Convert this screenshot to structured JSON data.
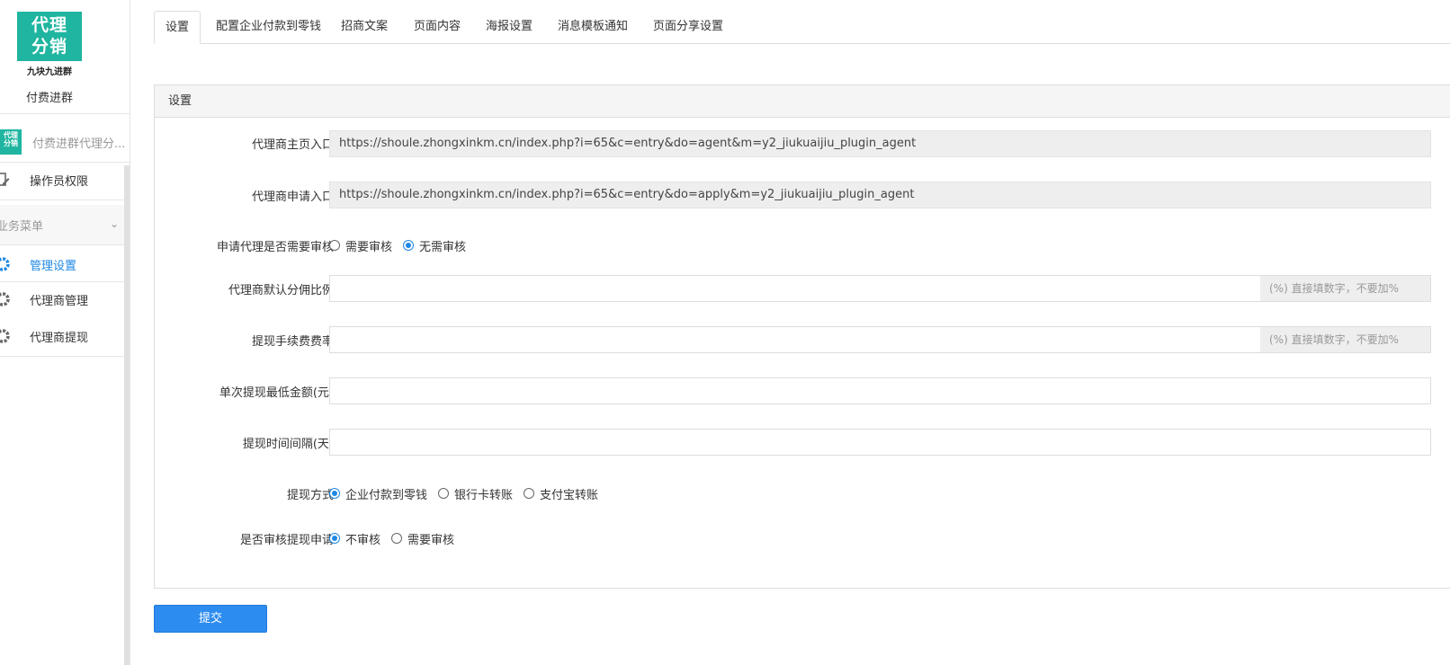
{
  "sidebar": {
    "logo_text_line1": "代理",
    "logo_text_line2": "分销",
    "logo_subtitle": "九块九进群",
    "app_name": "付费进群",
    "module": {
      "thumb_line1": "代理",
      "thumb_line2": "分销",
      "label": "付费进群代理分..."
    },
    "operator_permissions": "操作员权限",
    "section_title": "业务菜单",
    "items": [
      {
        "label": "管理设置",
        "icon": "gear-icon",
        "active": true
      },
      {
        "label": "代理商管理",
        "icon": "gear-icon",
        "active": false
      },
      {
        "label": "代理商提现",
        "icon": "gear-icon",
        "active": false
      }
    ],
    "accent_color": "#1e88e5",
    "logo_color": "#1fb5a0"
  },
  "tabs": [
    {
      "label": "设置",
      "active": true
    },
    {
      "label": "配置企业付款到零钱"
    },
    {
      "label": "招商文案"
    },
    {
      "label": "页面内容"
    },
    {
      "label": "海报设置"
    },
    {
      "label": "消息模板通知"
    },
    {
      "label": "页面分享设置"
    }
  ],
  "panel": {
    "title": "设置",
    "agent_home": {
      "label": "代理商主页入口",
      "value": "https://shoule.zhongxinkm.cn/index.php?i=65&c=entry&do=agent&m=y2_jiukuaijiu_plugin_agent"
    },
    "agent_apply": {
      "label": "代理商申请入口",
      "value": "https://shoule.zhongxinkm.cn/index.php?i=65&c=entry&do=apply&m=y2_jiukuaijiu_plugin_agent"
    },
    "apply_review": {
      "label": "申请代理是否需要审核",
      "options": [
        "需要审核",
        "无需审核"
      ],
      "selected": "无需审核"
    },
    "default_commission": {
      "label": "代理商默认分佣比例",
      "value": "",
      "addon": "(%) 直接填数字，不要加%"
    },
    "withdraw_fee": {
      "label": "提现手续费费率",
      "value": "",
      "addon": "(%) 直接填数字，不要加%"
    },
    "min_withdraw": {
      "label": "单次提现最低金额(元)",
      "value": ""
    },
    "withdraw_interval": {
      "label": "提现时间间隔(天)",
      "value": ""
    },
    "withdraw_method": {
      "label": "提现方式",
      "options": [
        "企业付款到零钱",
        "银行卡转账",
        "支付宝转账"
      ],
      "selected": "企业付款到零钱"
    },
    "withdraw_review": {
      "label": "是否审核提现申请",
      "options": [
        "不审核",
        "需要审核"
      ],
      "selected": "不审核"
    }
  },
  "submit_label": "提交",
  "primary_color": "#2d8cf0"
}
